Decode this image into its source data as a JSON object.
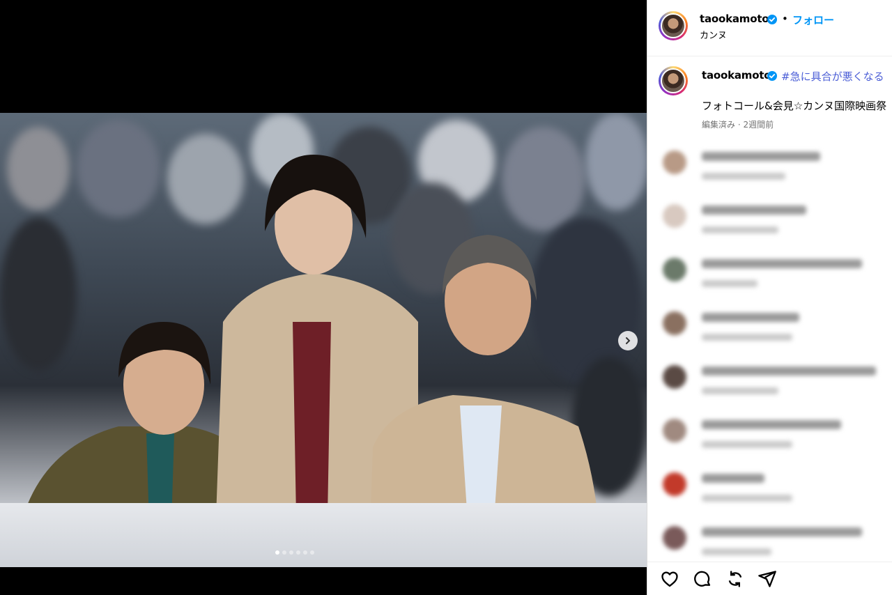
{
  "post": {
    "username": "taookamoto",
    "location": "カンヌ",
    "separator": "•",
    "follow_label": "フォロー",
    "caption_hashtag": "#急に具合が悪くなる",
    "caption_text": "フォトコール&会見☆カンヌ国際映画祭",
    "meta": "編集済み · 2週間前"
  },
  "carousel": {
    "total_dots": 6,
    "active_index": 0
  },
  "comments": [
    {
      "avatar_color": "#b89a86",
      "name_width": 170,
      "line2_width": 120,
      "name_color": "#9a9a9a"
    },
    {
      "avatar_color": "#d8c9c0",
      "name_width": 150,
      "line2_width": 110,
      "name_color": "#9a9a9a"
    },
    {
      "avatar_color": "#6b7a6a",
      "name_width": 230,
      "line2_width": 80,
      "name_color": "#9a9a9a"
    },
    {
      "avatar_color": "#8a7060",
      "name_width": 140,
      "line2_width": 130,
      "name_color": "#9a9a9a"
    },
    {
      "avatar_color": "#5a4a44",
      "name_width": 250,
      "line2_width": 110,
      "name_color": "#9a9a9a"
    },
    {
      "avatar_color": "#a08a80",
      "name_width": 200,
      "line2_width": 130,
      "name_color": "#9a9a9a"
    },
    {
      "avatar_color": "#c23a2a",
      "name_width": 90,
      "line2_width": 130,
      "name_color": "#9a9a9a"
    },
    {
      "avatar_color": "#7a5a5a",
      "name_width": 230,
      "line2_width": 100,
      "name_color": "#9a9a9a"
    }
  ],
  "actions": [
    "heart-icon",
    "comment-icon",
    "share-icon",
    "send-icon"
  ],
  "colors": {
    "follow": "#0095f6",
    "hashtag": "#4a5dd6",
    "verified": "#0095f6"
  }
}
